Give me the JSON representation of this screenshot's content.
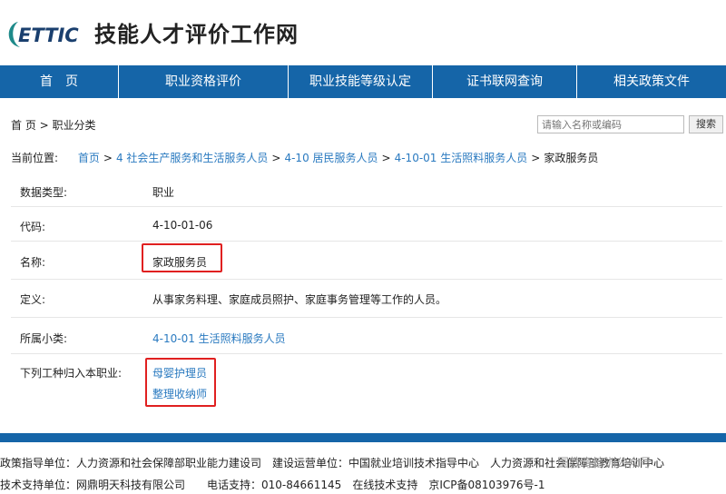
{
  "header": {
    "logo_text": "ETTIC",
    "title": "技能人才评价工作网"
  },
  "nav": [
    {
      "label": "首　页"
    },
    {
      "label": "职业资格评价"
    },
    {
      "label": "职业技能等级认定"
    },
    {
      "label": "证书联网查询"
    },
    {
      "label": "相关政策文件"
    }
  ],
  "crumb": "首 页 > 职业分类",
  "search": {
    "placeholder": "请输入名称或编码",
    "button": "搜索"
  },
  "location": {
    "prefix": "当前位置:",
    "links": [
      "首页",
      "4 社会生产服务和生活服务人员",
      "4-10 居民服务人员",
      "4-10-01 生活照料服务人员"
    ],
    "current": "家政服务员",
    "sep": ">"
  },
  "detail": {
    "type_label": "数据类型:",
    "type_value": "职业",
    "code_label": "代码:",
    "code_value": "4-10-01-06",
    "name_label": "名称:",
    "name_value": "家政服务员",
    "def_label": "定义:",
    "def_value": "从事家务料理、家庭成员照护、家庭事务管理等工作的人员。",
    "sub_label": "所属小类:",
    "sub_value": "4-10-01 生活照料服务人员",
    "jobs_label": "下列工种归入本职业:",
    "jobs": [
      "母婴护理员",
      "整理收纳师"
    ]
  },
  "footer": {
    "line1": "政策指导单位：人力资源和社会保障部职业能力建设司　建设运营单位：中国就业培训技术指导中心　人力资源和社会保障部教育培训中心",
    "line2": "技术支持单位：网鼎明天科技有限公司　　电话支持：010-84661145　在线技术支持　京ICP备08103976号-1"
  },
  "watermark": "国教育培训公众号"
}
